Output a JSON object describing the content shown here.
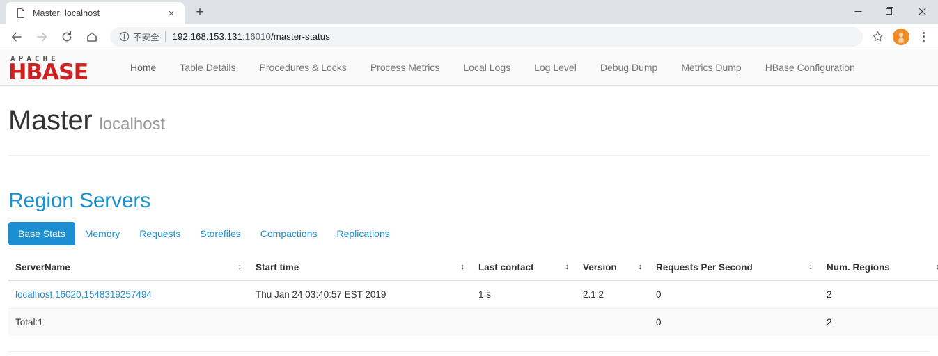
{
  "browser": {
    "tab": {
      "title": "Master: localhost",
      "favicon_icon": "page-icon",
      "close_label": "×"
    },
    "new_tab_label": "+",
    "window_controls": {
      "minimize": "—",
      "maximize": "❐",
      "close": "✕"
    },
    "toolbar": {
      "back_icon": "back-arrow-icon",
      "forward_icon": "forward-arrow-icon",
      "reload_icon": "reload-icon",
      "home_icon": "home-icon",
      "security_icon": "info-circle-icon",
      "security_label": "不安全",
      "url_host": "192.168.153.131",
      "url_port": ":16010",
      "url_path": "/master-status",
      "url_full": "192.168.153.131:16010/master-status",
      "bookmark_icon": "star-icon",
      "avatar_icon": "profile-avatar-icon",
      "menu_icon": "three-dot-menu-icon"
    }
  },
  "navbar": {
    "brand_top": "A P A C H E",
    "brand_main": "HBASE",
    "links": [
      {
        "label": "Home",
        "active": true
      },
      {
        "label": "Table Details",
        "active": false
      },
      {
        "label": "Procedures & Locks",
        "active": false
      },
      {
        "label": "Process Metrics",
        "active": false
      },
      {
        "label": "Local Logs",
        "active": false
      },
      {
        "label": "Log Level",
        "active": false
      },
      {
        "label": "Debug Dump",
        "active": false
      },
      {
        "label": "Metrics Dump",
        "active": false
      },
      {
        "label": "HBase Configuration",
        "active": false
      }
    ]
  },
  "page": {
    "title": "Master",
    "subtitle": "localhost"
  },
  "region_servers": {
    "heading": "Region Servers",
    "tabs": [
      {
        "label": "Base Stats",
        "active": true
      },
      {
        "label": "Memory",
        "active": false
      },
      {
        "label": "Requests",
        "active": false
      },
      {
        "label": "Storefiles",
        "active": false
      },
      {
        "label": "Compactions",
        "active": false
      },
      {
        "label": "Replications",
        "active": false
      }
    ],
    "columns": [
      "ServerName",
      "Start time",
      "Last contact",
      "Version",
      "Requests Per Second",
      "Num. Regions"
    ],
    "sort_icon": "↕",
    "rows": [
      {
        "server_name": "localhost,16020,1548319257494",
        "start_time": "Thu Jan 24 03:40:57 EST 2019",
        "last_contact": "1 s",
        "version": "2.1.2",
        "requests_per_second": "0",
        "num_regions": "2"
      }
    ],
    "total_row": {
      "label": "Total:1",
      "start_time": "",
      "last_contact": "",
      "version": "",
      "requests_per_second": "0",
      "num_regions": "2"
    }
  },
  "colors": {
    "accent": "#1b8fd0",
    "link": "#2a8fd0",
    "brand_red": "#cc2222",
    "avatar": "#f08c28"
  }
}
